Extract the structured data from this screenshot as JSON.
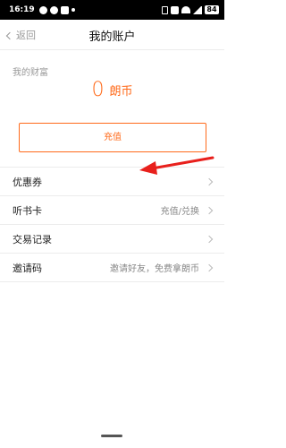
{
  "status_bar": {
    "time": "16:19",
    "battery": "84"
  },
  "nav": {
    "back_label": "返回",
    "title": "我的账户"
  },
  "wealth": {
    "label": "我的财富",
    "amount": "0",
    "unit": "朗币",
    "recharge_label": "充值"
  },
  "menu": {
    "items": [
      {
        "label": "优惠券",
        "value": ""
      },
      {
        "label": "听书卡",
        "value": "充值/兑换"
      },
      {
        "label": "交易记录",
        "value": ""
      },
      {
        "label": "邀请码",
        "value": "邀请好友，免费拿朗币"
      }
    ]
  },
  "colors": {
    "accent": "#ff6a1a",
    "annotation": "#e8201c"
  }
}
